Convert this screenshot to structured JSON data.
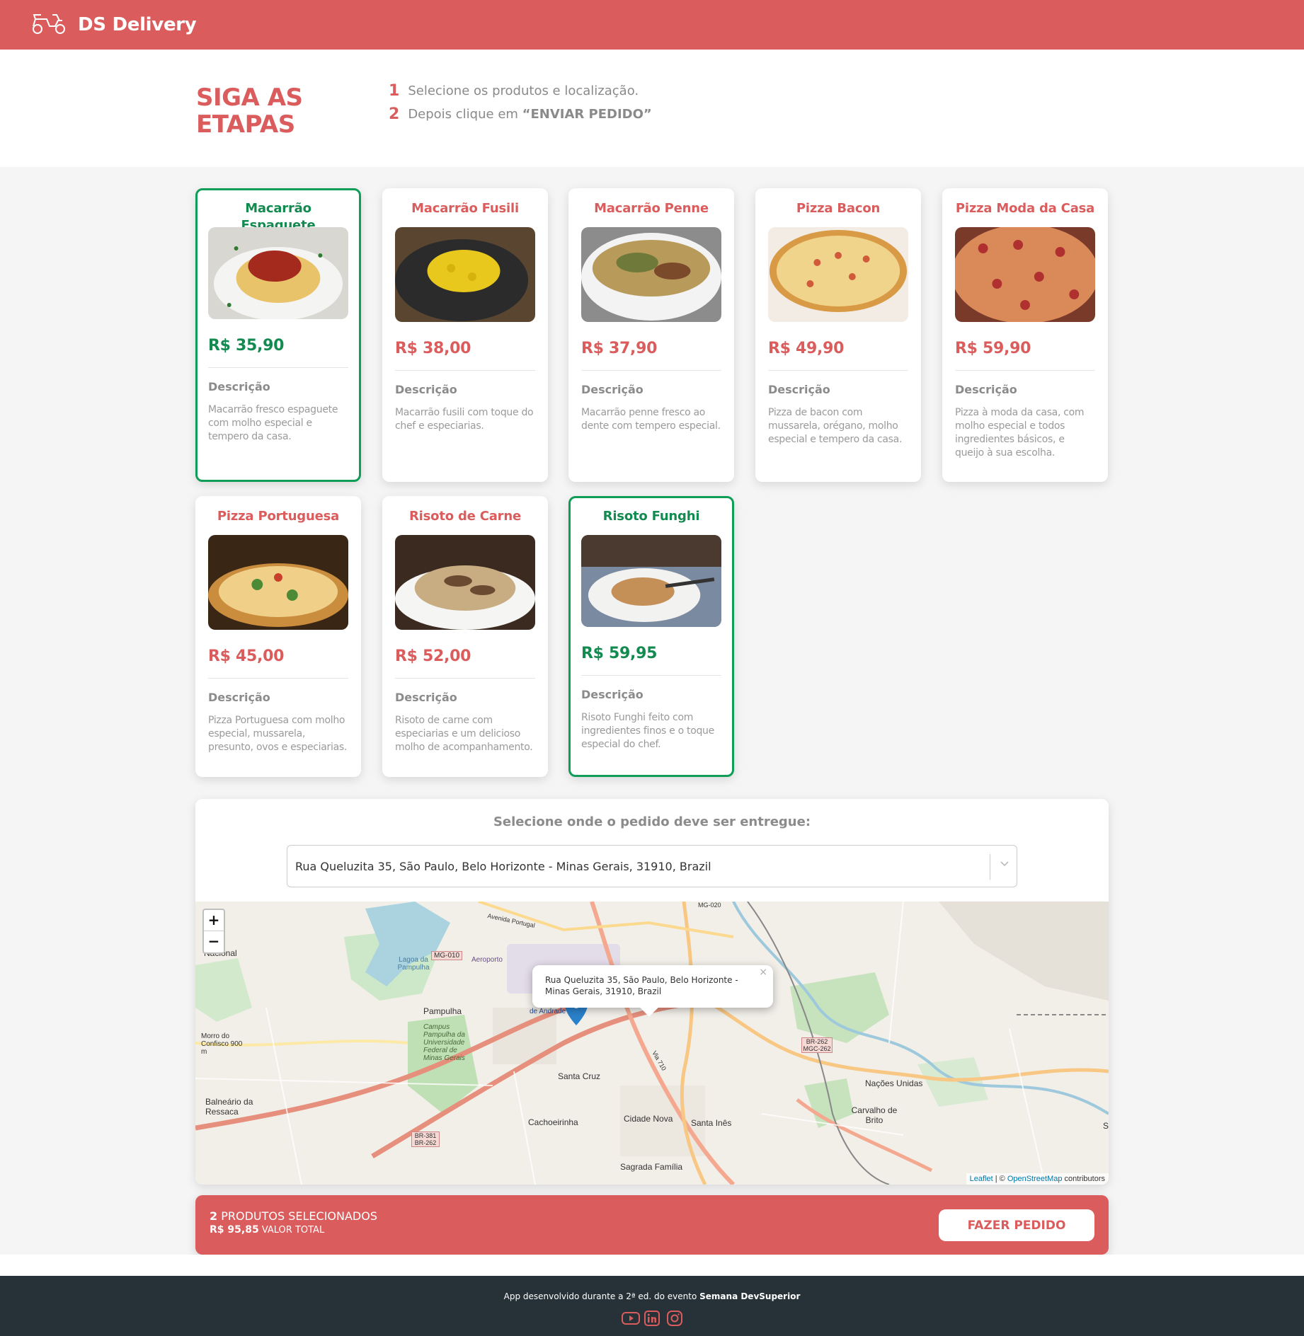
{
  "navbar": {
    "brand": "DS Delivery",
    "logo_icon": "scooter-icon"
  },
  "steps": {
    "title": "SIGA AS ETAPAS",
    "items": [
      {
        "number": "1",
        "text": "Selecione os produtos e localização."
      },
      {
        "number": "2",
        "text": "Depois clique em ",
        "emphasis": "“ENVIAR PEDIDO”"
      }
    ]
  },
  "products": [
    {
      "name": "Macarrão Espaguete",
      "price": "R$ 35,90",
      "desc_title": "Descrição",
      "description": "Macarrão fresco espaguete com molho especial e tempero da casa.",
      "selected": true
    },
    {
      "name": "Macarrão Fusili",
      "price": "R$ 38,00",
      "desc_title": "Descrição",
      "description": "Macarrão fusili com toque do chef e especiarias.",
      "selected": false
    },
    {
      "name": "Macarrão Penne",
      "price": "R$ 37,90",
      "desc_title": "Descrição",
      "description": "Macarrão penne fresco ao dente com tempero especial.",
      "selected": false
    },
    {
      "name": "Pizza Bacon",
      "price": "R$ 49,90",
      "desc_title": "Descrição",
      "description": "Pizza de bacon com mussarela, orégano, molho especial e tempero da casa.",
      "selected": false
    },
    {
      "name": "Pizza Moda da Casa",
      "price": "R$ 59,90",
      "desc_title": "Descrição",
      "description": "Pizza à moda da casa, com molho especial e todos ingredientes básicos, e queijo à sua escolha.",
      "selected": false
    },
    {
      "name": "Pizza Portuguesa",
      "price": "R$ 45,00",
      "desc_title": "Descrição",
      "description": "Pizza Portuguesa com molho especial, mussarela, presunto, ovos e especiarias.",
      "selected": false
    },
    {
      "name": "Risoto de Carne",
      "price": "R$ 52,00",
      "desc_title": "Descrição",
      "description": "Risoto de carne com especiarias e um delicioso molho de acompanhamento.",
      "selected": false
    },
    {
      "name": "Risoto Funghi",
      "price": "R$ 59,95",
      "desc_title": "Descrição",
      "description": "Risoto Funghi feito com ingredientes finos e o toque especial do chef.",
      "selected": true
    }
  ],
  "location": {
    "title": "Selecione onde o pedido deve ser entregue:",
    "selected_address": "Rua Queluzita 35, São Paulo, Belo Horizonte - Minas Gerais, 31910, Brazil",
    "popup_text": "Rua Queluzita 35, São Paulo, Belo Horizonte - Minas Gerais, 31910, Brazil",
    "popup_close": "×",
    "zoom_in": "+",
    "zoom_out": "−",
    "attribution_leaflet": "Leaflet",
    "attribution_sep": " | © ",
    "attribution_osm": "OpenStreetMap",
    "attribution_tail": " contributors",
    "map_labels": [
      "Nacional",
      "Aeroporto",
      "Lagoa da Pampulha",
      "MG-010",
      "Avenida Portugal",
      "Pampulha",
      "Campus Pampulha da Universidade Federal de Minas Gerais",
      "Morro do Confisco 900 m",
      "Balneário da Ressaca",
      "Santa Cruz",
      "Cachoeirinha",
      "Cidade Nova",
      "Santa Inês",
      "Sagrada Família",
      "Nações Unidas",
      "Carvalho de Brito",
      "BR-262 MGC-262",
      "BR-381 BR-262",
      "de Andrade",
      "MG-020",
      "Via 710",
      "S"
    ]
  },
  "summary": {
    "count": "2",
    "count_label": " PRODUTOS SELECIONADOS",
    "total": "R$ 95,85",
    "total_label": " VALOR TOTAL",
    "button": "FAZER PEDIDO"
  },
  "footer": {
    "text": "App desenvolvido durante a 2ª ed. do evento ",
    "event": "Semana DevSuperior",
    "icons": [
      "youtube-icon",
      "linkedin-icon",
      "instagram-icon"
    ]
  },
  "colors": {
    "primary": "#DA5C5C",
    "selected": "#0F9D58",
    "footer": "#263238"
  }
}
